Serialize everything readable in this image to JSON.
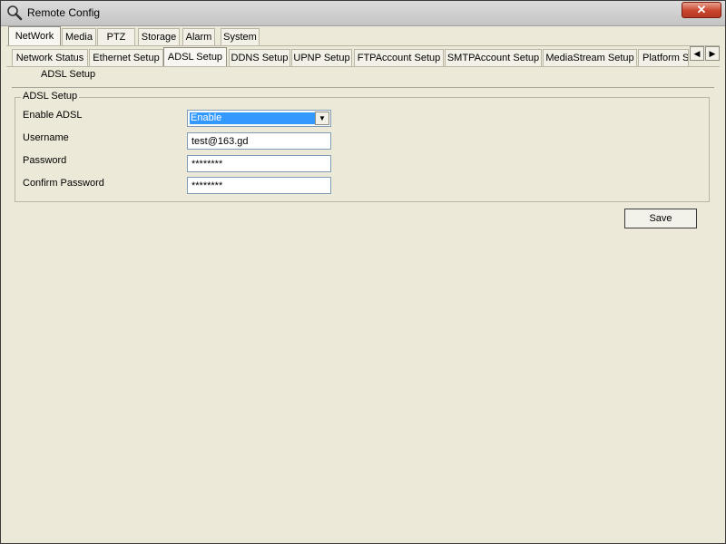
{
  "window": {
    "title": "Remote Config",
    "close_glyph": "✕"
  },
  "main_tabs": [
    {
      "label": "NetWork",
      "active": true
    },
    {
      "label": "Media"
    },
    {
      "label": "PTZ"
    },
    {
      "label": "Storage"
    },
    {
      "label": "Alarm"
    },
    {
      "label": "System"
    }
  ],
  "sub_tabs": [
    {
      "label": "Network Status"
    },
    {
      "label": "Ethernet Setup"
    },
    {
      "label": "ADSL Setup",
      "active": true
    },
    {
      "label": "DDNS Setup"
    },
    {
      "label": "UPNP Setup"
    },
    {
      "label": "FTPAccount Setup"
    },
    {
      "label": "SMTPAccount Setup"
    },
    {
      "label": "MediaStream Setup"
    },
    {
      "label": "Platform S"
    }
  ],
  "scroll": {
    "left_glyph": "◀",
    "right_glyph": "▶"
  },
  "subsection": {
    "label": "ADSL Setup"
  },
  "group": {
    "title": "ADSL Setup"
  },
  "form": {
    "enable_label": "Enable ADSL",
    "enable_value": "Enable",
    "dropdown_glyph": "▼",
    "username_label": "Username",
    "username_value": "test@163.gd",
    "password_label": "Password",
    "password_value": "********",
    "confirm_label": "Confirm Password",
    "confirm_value": "********"
  },
  "actions": {
    "save_label": "Save"
  },
  "icons": {
    "app": "magnifier-icon",
    "close": "close-icon"
  }
}
